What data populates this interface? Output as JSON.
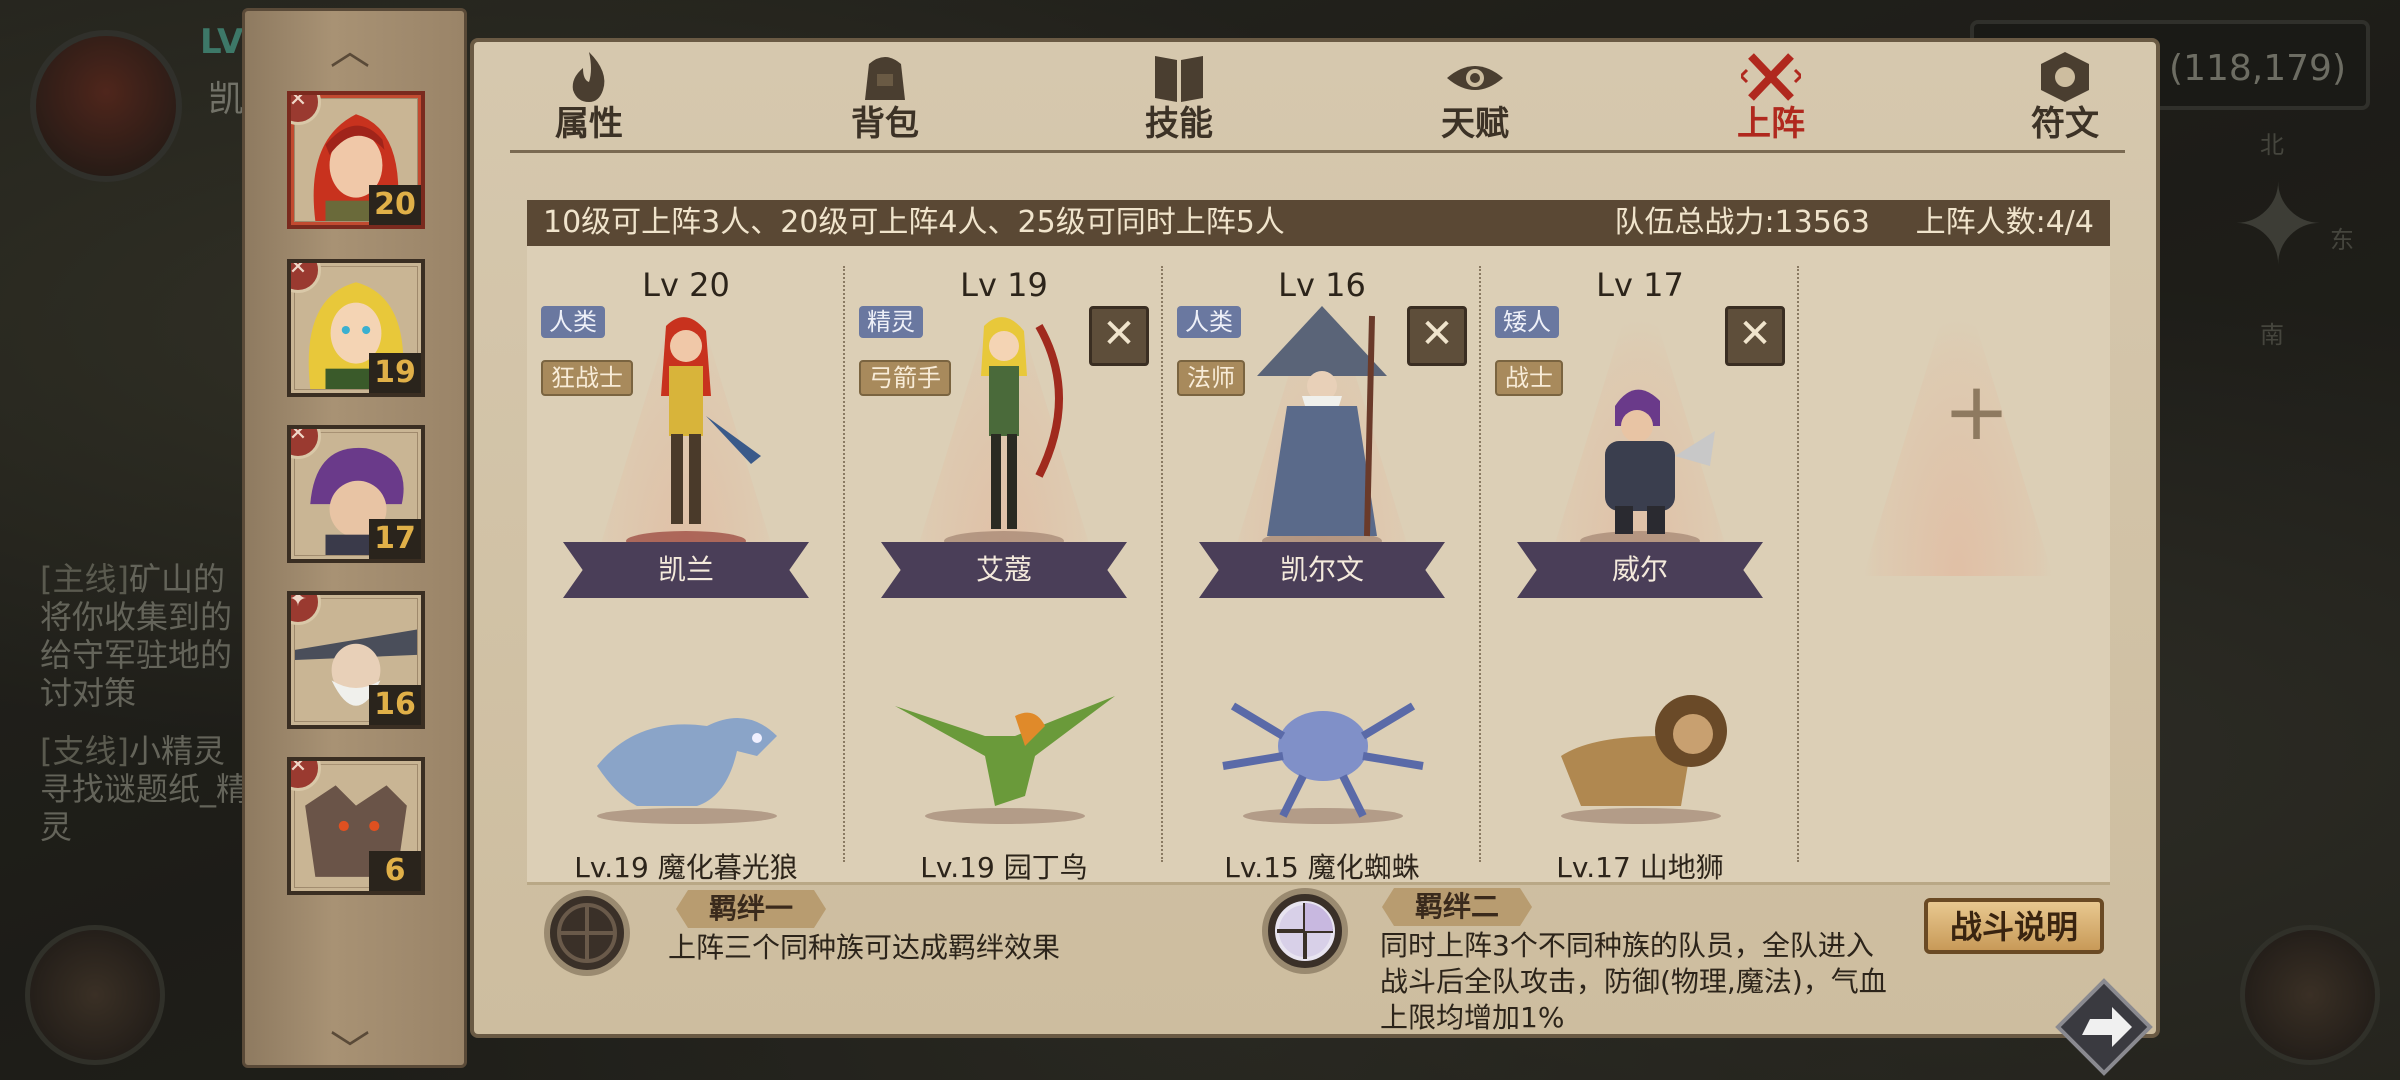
{
  "map": {
    "player_level": "LV",
    "player_name": "凯",
    "coords": "(118,179)",
    "compass": {
      "north": "北",
      "east": "东",
      "south": "南"
    },
    "quests": [
      {
        "tag": "[主线]",
        "title": "矿山的",
        "desc": "将你收集到的给守军驻地的讨对策"
      },
      {
        "tag": "[支线]",
        "title": "小精灵",
        "desc": "寻找谜题纸_精灵"
      }
    ]
  },
  "sidebar": {
    "heroes": [
      {
        "level": "20",
        "badge": "✕"
      },
      {
        "level": "19",
        "badge": "✕"
      },
      {
        "level": "17",
        "badge": "✕"
      },
      {
        "level": "16",
        "badge": "✦"
      },
      {
        "level": "6",
        "badge": "✕"
      }
    ]
  },
  "tabs": [
    {
      "label": "属性",
      "icon": "fire-icon"
    },
    {
      "label": "背包",
      "icon": "backpack-icon"
    },
    {
      "label": "技能",
      "icon": "book-icon"
    },
    {
      "label": "天赋",
      "icon": "eye-icon"
    },
    {
      "label": "上阵",
      "icon": "crossed-swords-icon"
    },
    {
      "label": "符文",
      "icon": "rune-icon"
    }
  ],
  "info": {
    "rule": "10级可上阵3人、20级可上阵4人、25级可同时上阵5人",
    "power": "队伍总战力:13563",
    "count": "上阵人数:4/4"
  },
  "team": [
    {
      "level": "Lv 20",
      "race": "人类",
      "class": "狂战士",
      "name": "凯兰",
      "pet": "Lv.19 魔化暮光狼",
      "removable": false
    },
    {
      "level": "Lv 19",
      "race": "精灵",
      "class": "弓箭手",
      "name": "艾蔻",
      "pet": "Lv.19 园丁鸟",
      "removable": true
    },
    {
      "level": "Lv 16",
      "race": "人类",
      "class": "法师",
      "name": "凯尔文",
      "pet": "Lv.15 魔化蜘蛛",
      "removable": true
    },
    {
      "level": "Lv 17",
      "race": "矮人",
      "class": "战士",
      "name": "威尔",
      "pet": "Lv.17 山地狮",
      "removable": true
    }
  ],
  "add_slot": {
    "symbol": "+"
  },
  "remove_symbol": "✕",
  "bonds": {
    "one": {
      "title": "羁绊一",
      "desc": "上阵三个同种族可达成羁绊效果"
    },
    "two": {
      "title": "羁绊二",
      "desc_lines": [
        "同时上阵3个不同种族的队员，全队进入",
        "战斗后全队攻击，防御(物理,魔法)，气血",
        "上限均增加1%"
      ]
    }
  },
  "buttons": {
    "battle_info": "战斗说明"
  },
  "colors": {
    "active_tab": "#b0281e",
    "panel": "#d6c8ae",
    "banner": "#4a3e58",
    "level_gold": "#e0b048"
  }
}
